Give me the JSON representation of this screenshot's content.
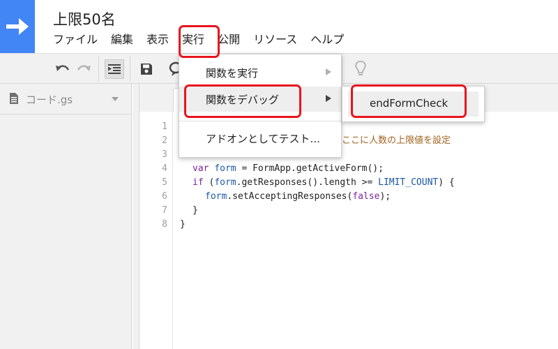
{
  "header": {
    "title": "上限50名",
    "menu": [
      "ファイル",
      "編集",
      "表示",
      "実行",
      "公開",
      "リソース",
      "ヘルプ"
    ]
  },
  "sidebar": {
    "file_name": "コード.gs"
  },
  "run_menu": {
    "items": [
      {
        "label": "関数を実行"
      },
      {
        "label": "関数をデバッグ"
      },
      {
        "label": "アドオンとしてテスト..."
      }
    ],
    "submenu": {
      "items": [
        {
          "label": "endFormCheck"
        }
      ]
    }
  },
  "editor": {
    "line_numbers": [
      "1",
      "2",
      "3",
      "4",
      "5",
      "6",
      "7",
      "8"
    ],
    "code": {
      "l2_comment": "ここに人数の上限値を設定",
      "l4_kw": "var",
      "l4_id": "form",
      "l4_rest": " = FormApp.getActiveForm();",
      "l5_kw": "if",
      "l5_open": " (",
      "l5_id": "form",
      "l5_mid": ".getResponses().length >= ",
      "l5_const": "LIMIT_COUNT",
      "l5_close": ") {",
      "l6_id": "form",
      "l6_mid": ".setAcceptingResponses(",
      "l6_kw": "false",
      "l6_end": ");",
      "l7": "}",
      "l8": "}"
    }
  },
  "colors": {
    "brand_blue": "#4285f4",
    "highlight_red": "#e8141e",
    "keyword": "#7e24a3",
    "identifier": "#1a57a6",
    "comment": "#a0631f"
  },
  "icons": {
    "logo": "arrow-right-icon",
    "undo": "undo-icon",
    "redo": "redo-icon",
    "indent": "indent-icon",
    "save": "save-icon",
    "comment": "speech-bubble-icon",
    "idea": "lightbulb-icon",
    "file": "document-icon",
    "caret": "chevron-down-icon",
    "submenu": "triangle-right-icon"
  }
}
